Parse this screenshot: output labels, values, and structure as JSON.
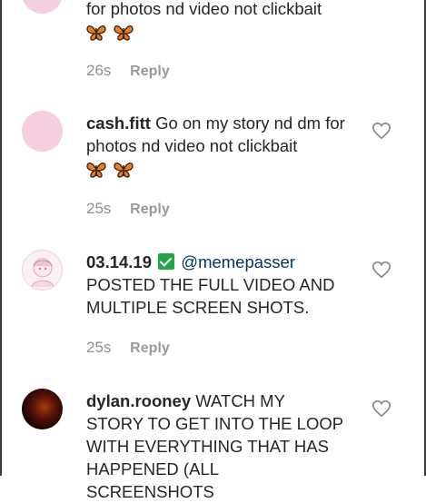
{
  "comments": [
    {
      "username": "",
      "text": "for photos nd video not clickbait",
      "emoji": "🦋🦋",
      "time": "26s",
      "reply": "Reply"
    },
    {
      "username": "cash.fitt",
      "text": " Go on my story nd dm for photos nd video not clickbait",
      "emoji": "🦋🦋",
      "time": "25s",
      "reply": "Reply"
    },
    {
      "username": "03.14.19",
      "mention": "@memepasser",
      "text": "POSTED THE FULL VIDEO AND MULTIPLE SCREEN SHOTS.",
      "time": "25s",
      "reply": "Reply"
    },
    {
      "username": "dylan.rooney",
      "text": " WATCH MY STORY TO GET INTO THE LOOP WITH EVERYTHING THAT HAS HAPPENED (ALL SCREENSHOTS"
    }
  ],
  "icons": {
    "heart": "heart-outline-icon",
    "butterfly": "butterfly-emoji",
    "check": "check-mark-emoji"
  },
  "colors": {
    "text": "#262626",
    "meta": "#8e8e8e",
    "mention": "#003569",
    "check_bg": "#22a54a"
  }
}
